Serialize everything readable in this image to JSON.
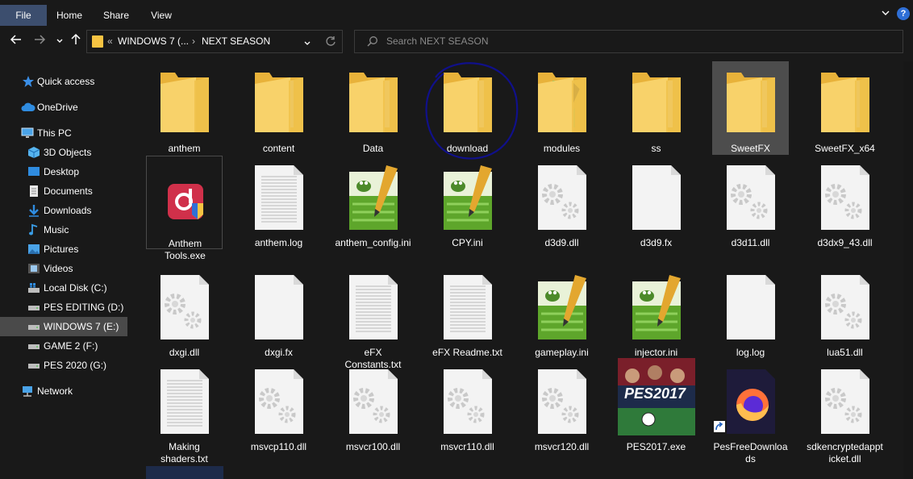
{
  "ribbon": {
    "tabs": [
      "File",
      "Home",
      "Share",
      "View"
    ],
    "help_icon": "help-icon",
    "accent": "#3c4e6e"
  },
  "address": {
    "crumb1": "WINDOWS 7 (...",
    "crumb2": "NEXT SEASON",
    "overflow": "«"
  },
  "search": {
    "placeholder": "Search NEXT SEASON"
  },
  "sidebar": {
    "items": [
      {
        "label": "Quick access",
        "icon": "star-icon"
      },
      {
        "label": "OneDrive",
        "icon": "cloud-icon"
      },
      {
        "label": "This PC",
        "icon": "monitor-icon"
      },
      {
        "label": "3D Objects",
        "icon": "cube-icon"
      },
      {
        "label": "Desktop",
        "icon": "desktop-icon"
      },
      {
        "label": "Documents",
        "icon": "document-icon"
      },
      {
        "label": "Downloads",
        "icon": "download-arrow-icon"
      },
      {
        "label": "Music",
        "icon": "music-note-icon"
      },
      {
        "label": "Pictures",
        "icon": "picture-icon"
      },
      {
        "label": "Videos",
        "icon": "film-icon"
      },
      {
        "label": "Local Disk (C:)",
        "icon": "windows-drive-icon"
      },
      {
        "label": "PES EDITING (D:)",
        "icon": "drive-icon"
      },
      {
        "label": "WINDOWS 7 (E:)",
        "icon": "drive-icon"
      },
      {
        "label": "GAME 2 (F:)",
        "icon": "drive-icon"
      },
      {
        "label": "PES 2020 (G:)",
        "icon": "drive-icon"
      },
      {
        "label": "Network",
        "icon": "network-icon"
      }
    ]
  },
  "files": [
    {
      "name": "anthem",
      "type": "folder"
    },
    {
      "name": "content",
      "type": "folder"
    },
    {
      "name": "Data",
      "type": "folder"
    },
    {
      "name": "download",
      "type": "folder"
    },
    {
      "name": "modules",
      "type": "folder"
    },
    {
      "name": "ss",
      "type": "folder"
    },
    {
      "name": "SweetFX",
      "type": "folder"
    },
    {
      "name": "SweetFX_x64",
      "type": "folder"
    },
    {
      "name": "Anthem Tools.exe",
      "type": "exe-anthem"
    },
    {
      "name": "anthem.log",
      "type": "text"
    },
    {
      "name": "anthem_config.ini",
      "type": "notepad"
    },
    {
      "name": "CPY.ini",
      "type": "notepad"
    },
    {
      "name": "d3d9.dll",
      "type": "dll"
    },
    {
      "name": "d3d9.fx",
      "type": "blank"
    },
    {
      "name": "d3d11.dll",
      "type": "dll"
    },
    {
      "name": "d3dx9_43.dll",
      "type": "dll"
    },
    {
      "name": "dxgi.dll",
      "type": "dll"
    },
    {
      "name": "dxgi.fx",
      "type": "blank"
    },
    {
      "name": "eFX Constants.txt",
      "type": "text"
    },
    {
      "name": "eFX Readme.txt",
      "type": "text"
    },
    {
      "name": "gameplay.ini",
      "type": "notepad"
    },
    {
      "name": "injector.ini",
      "type": "notepad"
    },
    {
      "name": "log.log",
      "type": "blank"
    },
    {
      "name": "lua51.dll",
      "type": "dll"
    },
    {
      "name": "Making shaders.txt",
      "type": "text"
    },
    {
      "name": "msvcp110.dll",
      "type": "dll"
    },
    {
      "name": "msvcr100.dll",
      "type": "dll"
    },
    {
      "name": "msvcr110.dll",
      "type": "dll"
    },
    {
      "name": "msvcr120.dll",
      "type": "dll"
    },
    {
      "name": "PES2017.exe",
      "type": "pes"
    },
    {
      "name": "PesFreeDownloads",
      "type": "firefox"
    },
    {
      "name": "sdkencryptedappticket.dll",
      "type": "dll"
    }
  ],
  "pes_cover_text": "PES2017",
  "colors": {
    "background": "#191919",
    "folder": "#f6c342",
    "selection": "#4d4d4d",
    "annotation": "#10108a"
  }
}
